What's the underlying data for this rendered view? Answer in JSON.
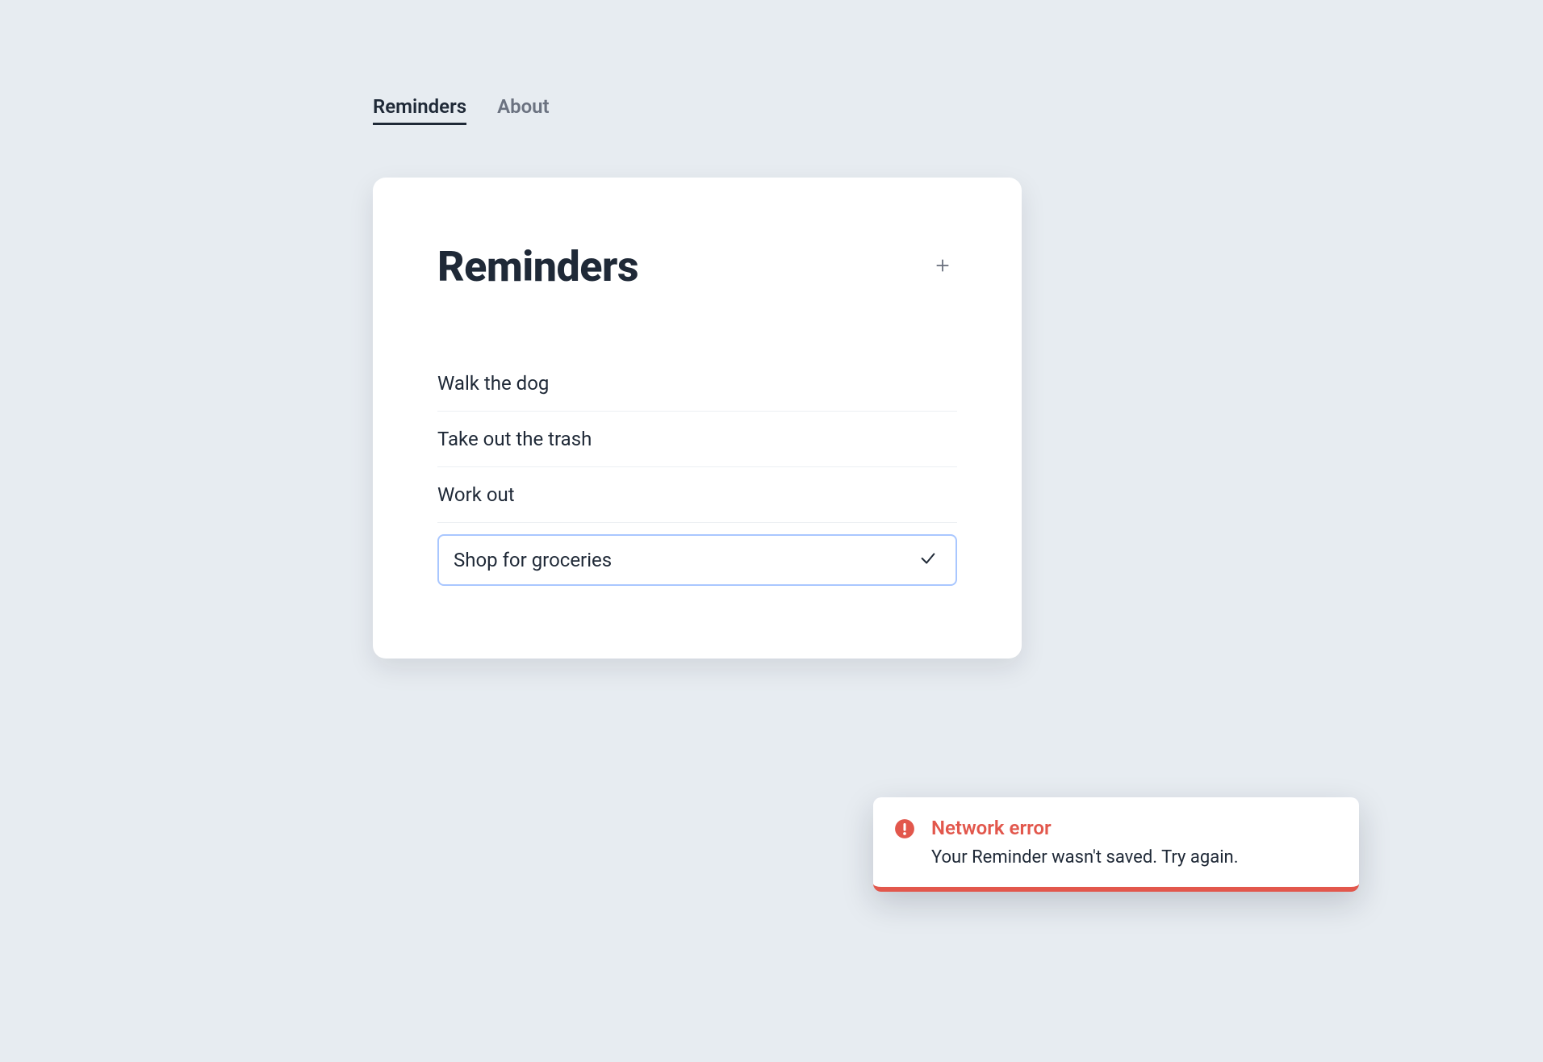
{
  "nav": {
    "items": [
      {
        "label": "Reminders",
        "active": true
      },
      {
        "label": "About",
        "active": false
      }
    ]
  },
  "card": {
    "title": "Reminders",
    "reminders": [
      {
        "text": "Walk the dog"
      },
      {
        "text": "Take out the trash"
      },
      {
        "text": "Work out"
      }
    ],
    "new_reminder_value": "Shop for groceries"
  },
  "toast": {
    "title": "Network error",
    "message": "Your Reminder wasn't saved. Try again."
  },
  "colors": {
    "bg": "#e7ecf1",
    "text": "#1f2937",
    "muted": "#6b7280",
    "focus_ring": "#a9c7ff",
    "error": "#e2574c"
  }
}
